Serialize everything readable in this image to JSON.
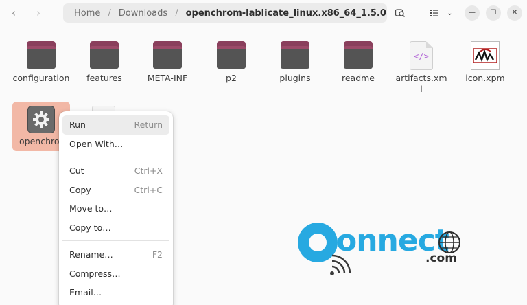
{
  "header": {
    "back_glyph": "‹",
    "forward_glyph": "›",
    "breadcrumb": {
      "home": "Home",
      "downloads": "Downloads",
      "current": "openchrom-lablicate_linux.x86_64_1.5.0",
      "separator": "/"
    },
    "path_menu_glyph": "⋮",
    "view_arrow_glyph": "⌄",
    "minimize_glyph": "—",
    "maximize_glyph": "☐",
    "close_glyph": "✕"
  },
  "files": [
    {
      "name": "configuration",
      "kind": "folder"
    },
    {
      "name": "features",
      "kind": "folder"
    },
    {
      "name": "META-INF",
      "kind": "folder"
    },
    {
      "name": "p2",
      "kind": "folder"
    },
    {
      "name": "plugins",
      "kind": "folder"
    },
    {
      "name": "readme",
      "kind": "folder"
    },
    {
      "name": "artifacts.xml",
      "kind": "xml-file"
    },
    {
      "name": "icon.xpm",
      "kind": "image-file"
    },
    {
      "name": "openchrom",
      "kind": "executable",
      "selected": true
    }
  ],
  "xml_glyph": "</>",
  "context_menu": {
    "items": [
      {
        "label": "Run",
        "accel": "Return",
        "highlighted": true
      },
      {
        "label": "Open With…",
        "accel": ""
      },
      {
        "label": "Cut",
        "accel": "Ctrl+X"
      },
      {
        "label": "Copy",
        "accel": "Ctrl+C"
      },
      {
        "label": "Move to…",
        "accel": ""
      },
      {
        "label": "Copy to…",
        "accel": ""
      },
      {
        "label": "Rename…",
        "accel": "F2"
      },
      {
        "label": "Compress…",
        "accel": ""
      },
      {
        "label": "Email…",
        "accel": ""
      }
    ]
  },
  "watermark": {
    "word": "onnect",
    "suffix": ".com",
    "brand_color": "#27a9e1"
  },
  "colors": {
    "selection": "#f2b8a6",
    "folder_tab": "#8a3f5c",
    "folder_body": "#545454",
    "xml_accent": "#b062d6"
  }
}
